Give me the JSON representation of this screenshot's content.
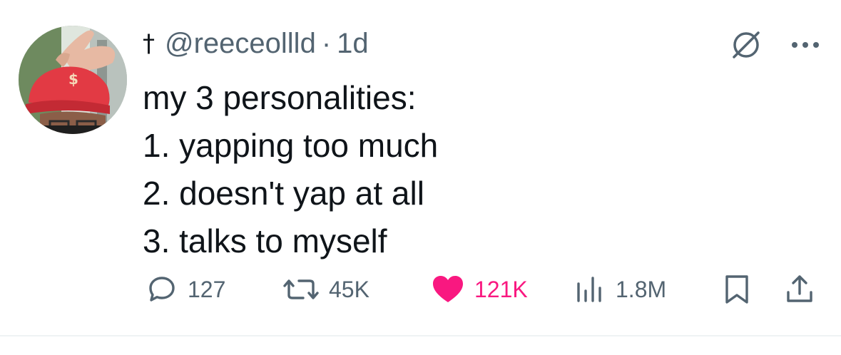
{
  "tweet": {
    "prefix_symbol": "†",
    "handle": "@reeceollld",
    "separator": "·",
    "time": "1d",
    "lines": [
      "my 3 personalities:",
      "1. yapping too much",
      "2. doesn't yap at all",
      "3. talks to myself"
    ]
  },
  "actions": {
    "replies": "127",
    "reposts": "45K",
    "likes": "121K",
    "views": "1.8M"
  },
  "icons": {
    "reply": "speech-bubble-icon",
    "repost": "repost-arrows-icon",
    "like": "heart-icon",
    "views": "bar-chart-icon",
    "bookmark": "bookmark-icon",
    "share": "share-upload-icon",
    "grok": "slashed-circle-icon",
    "more": "more-dots-icon"
  },
  "colors": {
    "like_active": "#f91880",
    "secondary_text": "#536471",
    "primary_text": "#0f1419",
    "avatar_cap": "#e23a44"
  }
}
